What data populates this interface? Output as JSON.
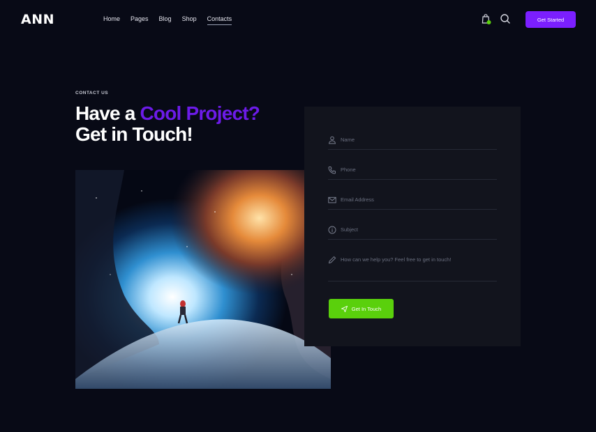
{
  "header": {
    "logo": "ANN",
    "nav": [
      "Home",
      "Pages",
      "Blog",
      "Shop",
      "Contacts"
    ],
    "active_nav": "Contacts",
    "cta": "Get Started"
  },
  "hero": {
    "eyebrow": "CONTACT US",
    "headline_part1": "Have a ",
    "headline_accent": "Cool Project?",
    "headline_part2": "Get in Touch!"
  },
  "form": {
    "fields": [
      {
        "icon": "user-icon",
        "placeholder": "Name"
      },
      {
        "icon": "phone-icon",
        "placeholder": "Phone"
      },
      {
        "icon": "mail-icon",
        "placeholder": "Email Address"
      },
      {
        "icon": "info-icon",
        "placeholder": "Subject"
      },
      {
        "icon": "pencil-icon",
        "placeholder": "How can we help you? Feel free to get in touch!"
      }
    ],
    "submit": "Get In Touch"
  },
  "colors": {
    "background": "#080a16",
    "accent_purple": "#7b1fff",
    "headline_accent": "#6c1be8",
    "accent_green": "#5ad00c",
    "card": "#12141d"
  }
}
